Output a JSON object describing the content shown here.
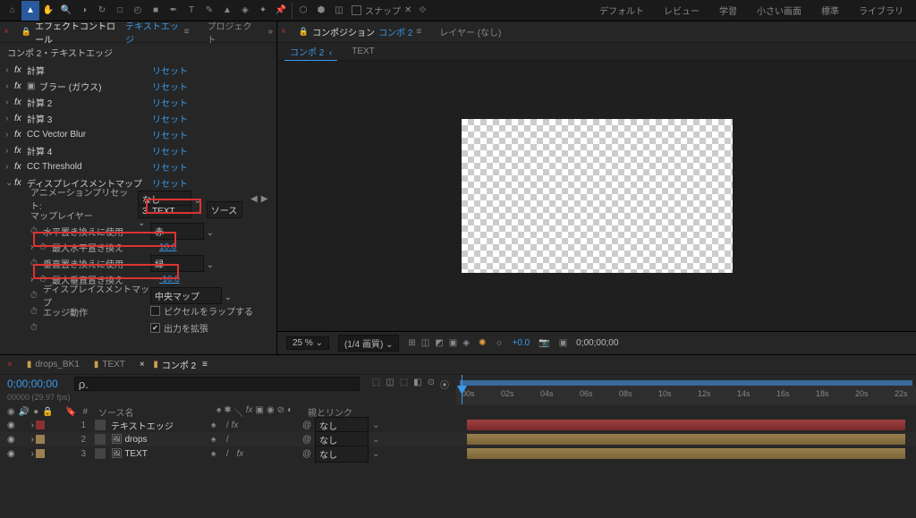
{
  "toolbar": {
    "snap_label": "スナップ",
    "workspaces": [
      "デフォルト",
      "レビュー",
      "学習",
      "小さい画面",
      "標準",
      "ライブラリ"
    ]
  },
  "effect_controls": {
    "tab_label": "エフェクトコントロール",
    "tab_target": "テキストエッジ",
    "project_tab": "プロジェクト",
    "breadcrumb": "コンポ 2・テキストエッジ",
    "reset_label": "リセット",
    "effects": [
      {
        "name": "計算"
      },
      {
        "name": "ブラー (ガウス)"
      },
      {
        "name": "計算 2"
      },
      {
        "name": "計算 3"
      },
      {
        "name": "CC Vector Blur"
      },
      {
        "name": "計算 4"
      },
      {
        "name": "CC Threshold"
      },
      {
        "name": "ディスプレイスメントマップ"
      }
    ],
    "preset_label": "アニメーションプリセット:",
    "preset_value": "なし",
    "props": {
      "map_layer_label": "マップレイヤー",
      "map_layer_value": "3. TEXT",
      "map_layer_source": "ソース",
      "h_use_label": "水平置き換えに使用",
      "h_use_value": "赤",
      "h_max_label": "最大水平置き換え",
      "h_max_value": "10.0",
      "v_use_label": "垂直置き換えに使用",
      "v_use_value": "緑",
      "v_max_label": "最大垂直置き換え",
      "v_max_value": "-10.0",
      "dmap_label": "ディスプレイスメントマップ",
      "dmap_value": "中央マップ",
      "edge_label": "エッジ動作",
      "wrap_label": "ピクセルをラップする",
      "expand_label": "出力を拡張"
    }
  },
  "composition": {
    "tab_label": "コンポジション",
    "tab_target": "コンポ 2",
    "layer_tab": "レイヤー (なし)",
    "sub_comp": "コンポ 2",
    "sub_text": "TEXT",
    "zoom": "25 %",
    "res": "(1/4 画質)",
    "exposure": "+0.0",
    "cur_time": "0;00;00;00"
  },
  "timeline": {
    "tabs": [
      {
        "label": "drops_BK1",
        "icon": "folder"
      },
      {
        "label": "TEXT",
        "icon": "folder"
      },
      {
        "label": "コンポ 2",
        "icon": "comp",
        "active": true
      }
    ],
    "timecode": "0;00;00;00",
    "fps": "00000 (29.97 fps)",
    "search_placeholder": "",
    "col_source": "ソース名",
    "col_parent": "親とリンク",
    "parent_none": "なし",
    "ruler": [
      "00s",
      "02s",
      "04s",
      "06s",
      "08s",
      "10s",
      "12s",
      "14s",
      "16s",
      "18s",
      "20s",
      "22s"
    ],
    "layers": [
      {
        "n": "1",
        "name": "テキストエッジ",
        "color": "red",
        "sw": "fx"
      },
      {
        "n": "2",
        "name": "drops",
        "color": "tan",
        "sw": ""
      },
      {
        "n": "3",
        "name": "TEXT",
        "color": "tan",
        "sw": "fx"
      }
    ]
  }
}
